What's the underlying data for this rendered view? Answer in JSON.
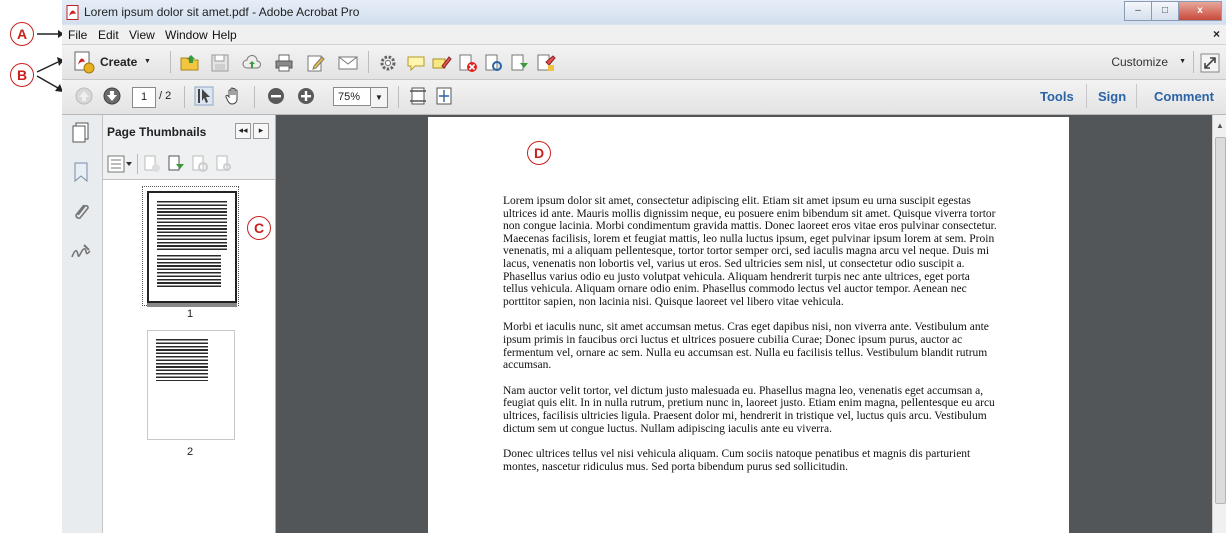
{
  "annotations": [
    "A",
    "B",
    "C",
    "D"
  ],
  "window": {
    "title": "Lorem ipsum dolor sit amet.pdf - Adobe Acrobat Pro",
    "minimize": "–",
    "maximize": "□",
    "close": "x"
  },
  "menubar": {
    "items": [
      "File",
      "Edit",
      "View",
      "Window",
      "Help"
    ],
    "close": "×"
  },
  "toolbar": {
    "create_label": "Create",
    "create_arrow": "▼",
    "customize_label": "Customize",
    "customize_arrow": "▼"
  },
  "navbar": {
    "current_page": "1",
    "total_pages": "/ 2",
    "zoom": "75%",
    "zoom_arrow": "▼",
    "tools": "Tools",
    "sign": "Sign",
    "comment": "Comment"
  },
  "thumbnails": {
    "title": "Page Thumbnails",
    "collapse_left": "◂◂",
    "collapse_right": "▸",
    "pages": [
      "1",
      "2"
    ]
  },
  "document": {
    "paragraphs": [
      "Lorem ipsum dolor sit amet, consectetur adipiscing elit. Etiam sit amet ipsum eu urna suscipit egestas ultrices id ante. Mauris mollis dignissim neque, eu posuere enim bibendum sit amet. Quisque viverra tortor non congue lacinia. Morbi condimentum gravida mattis. Donec laoreet eros vitae eros pulvinar consectetur. Maecenas facilisis, lorem et feugiat mattis, leo nulla luctus ipsum, eget pulvinar ipsum lorem at sem. Proin venenatis, mi a aliquam pellentesque, tortor tortor semper orci, sed iaculis magna arcu vel neque. Duis mi lacus, venenatis non lobortis vel, varius ut eros. Sed ultricies sem nisl, ut consectetur odio suscipit a. Phasellus varius odio eu justo volutpat vehicula. Aliquam hendrerit turpis nec ante ultrices, eget porta tellus vehicula. Aliquam ornare odio enim. Phasellus commodo lectus vel auctor tempor. Aenean nec porttitor sapien, non lacinia nisi. Quisque laoreet vel libero vitae vehicula.",
      "Morbi et iaculis nunc, sit amet accumsan metus. Cras eget dapibus nisi, non viverra ante. Vestibulum ante ipsum primis in faucibus orci luctus et ultrices posuere cubilia Curae; Donec ipsum purus, auctor ac fermentum vel, ornare ac sem. Nulla eu accumsan est. Nulla eu facilisis tellus. Vestibulum blandit rutrum accumsan.",
      "Nam auctor velit tortor, vel dictum justo malesuada eu. Phasellus magna leo, venenatis eget accumsan a, feugiat quis elit. In in nulla rutrum, pretium nunc in, laoreet justo. Etiam enim magna, pellentesque eu arcu ultrices, facilisis ultricies ligula. Praesent dolor mi, hendrerit in tristique vel, luctus quis arcu. Vestibulum dictum sem ut congue luctus. Nullam adipiscing iaculis ante eu viverra.",
      "Donec ultrices tellus vel nisi vehicula aliquam. Cum sociis natoque penatibus et magnis dis parturient montes, nascetur ridiculus mus. Sed porta bibendum purus sed sollicitudin."
    ]
  },
  "colors": {
    "annotation": "#c8201c",
    "link": "#2a63a6",
    "doc_background": "#525659"
  }
}
